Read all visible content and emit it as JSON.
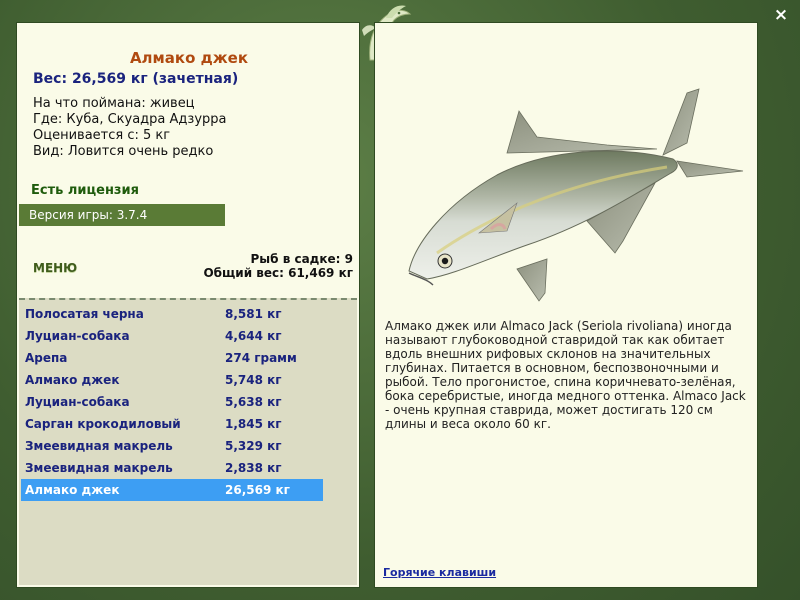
{
  "close_icon": "×",
  "fish": {
    "name": "Алмако джек",
    "weight_line": "Вес: 26,569 кг (зачетная)",
    "info": [
      "На что поймана: живец",
      "Где: Куба, Скуадра Адзурра",
      "Оценивается с: 5 кг",
      "Вид: Ловится очень редко"
    ],
    "description": "Алмако джек или Almaco Jack (Seriola rivoliana) иногда называют глубоководной ставридой так как обитает вдоль внешних рифовых склонов на значительных глубинах. Питается в основном, беспозвоночными и рыбой. Тело прогонистое, спина коричневато-зелёная, бока серебристые, иногда медного оттенка. Almaco Jack - очень крупная ставрида, может достигать 120 см длины и веса около 60 кг."
  },
  "license_text": "Есть лицензия",
  "version_text": "Версия игры: 3.7.4",
  "menu_label": "МЕНЮ",
  "keep_count": "Рыб в садке: 9",
  "total_weight": "Общий вес: 61,469 кг",
  "catch_list": [
    {
      "name": "Полосатая черна",
      "weight": "8,581 кг"
    },
    {
      "name": "Луциан-собака",
      "weight": "4,644 кг"
    },
    {
      "name": "Арепа",
      "weight": "274 грамм"
    },
    {
      "name": "Алмако джек",
      "weight": "5,748 кг"
    },
    {
      "name": "Луциан-собака",
      "weight": "5,638 кг"
    },
    {
      "name": "Сарган крокодиловый",
      "weight": "1,845 кг"
    },
    {
      "name": "Змеевидная макрель",
      "weight": "5,329 кг"
    },
    {
      "name": "Змеевидная макрель",
      "weight": "2,838 кг"
    },
    {
      "name": "Алмако джек",
      "weight": "26,569 кг"
    }
  ],
  "selected_index": 8,
  "hotkeys_label": "Горячие клавиши",
  "icons": {
    "logo": "fish-logo-icon",
    "close": "close-icon"
  },
  "colors": {
    "title": "#b04a10",
    "weight": "#1a237e",
    "license": "#1e5b0c",
    "selected_row": "#3d9ef3",
    "version_bar": "#5a7b36"
  }
}
